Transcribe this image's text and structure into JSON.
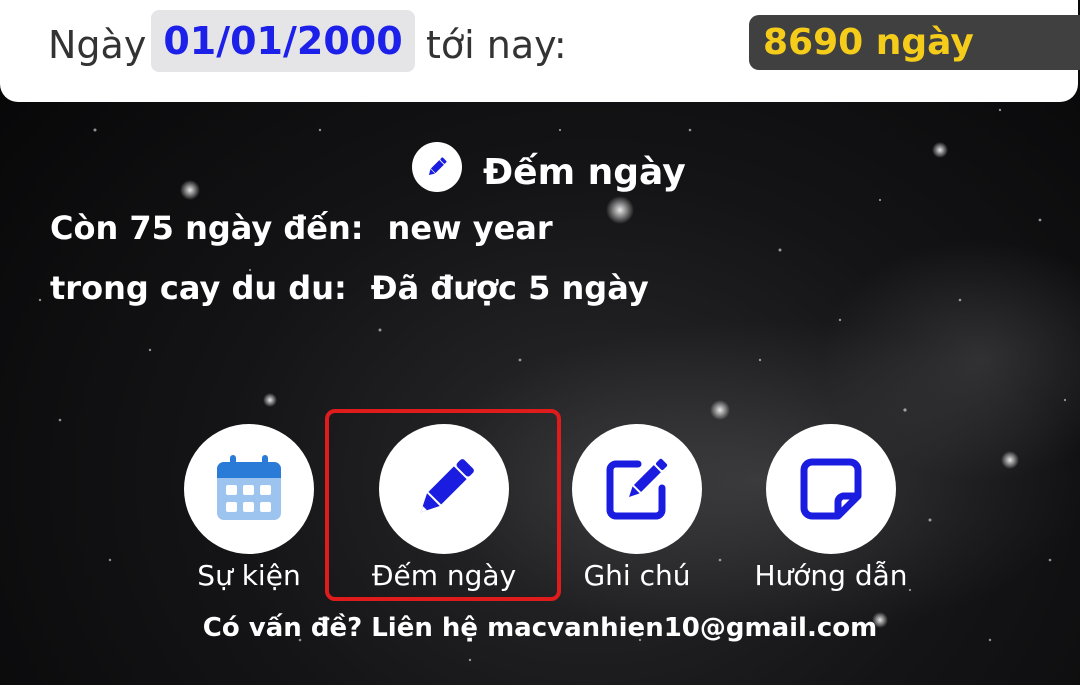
{
  "header": {
    "prefix": "Ngày",
    "date": "01/01/2000",
    "suffix": "tới nay:",
    "day_count": "8690 ngày",
    "date_color": "#1c20e8",
    "count_color": "#f6cc1a"
  },
  "section": {
    "title": "Đếm ngày",
    "icon": "pencil-icon"
  },
  "counters": [
    {
      "label": "Còn 75 ngày đến:",
      "value": "new year"
    },
    {
      "label": "trong cay du du:",
      "value": "Đã được 5 ngày"
    }
  ],
  "nav": {
    "items": [
      {
        "label": "Sự kiện",
        "icon": "calendar-icon",
        "selected": false
      },
      {
        "label": "Đếm ngày",
        "icon": "pencil-icon",
        "selected": true
      },
      {
        "label": "Ghi chú",
        "icon": "edit-note-icon",
        "selected": false
      },
      {
        "label": "Hướng dẫn",
        "icon": "sticky-note-icon",
        "selected": false
      }
    ],
    "highlight_color": "#e01b1b"
  },
  "footer": {
    "contact": "Có vấn đề? Liên hệ macvanhien10@gmail.com"
  }
}
